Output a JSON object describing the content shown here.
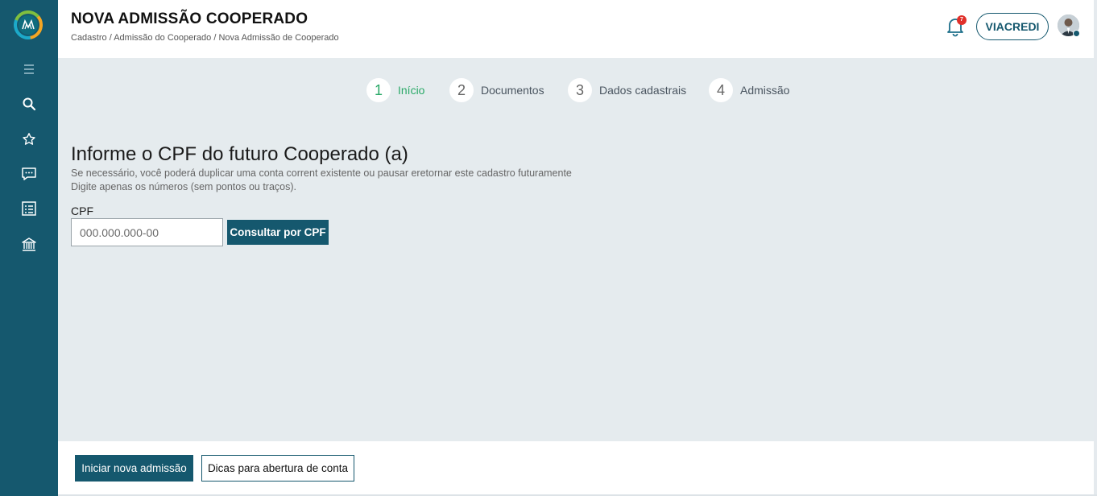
{
  "header": {
    "title": "NOVA ADMISSÃO COOPERADO",
    "breadcrumb": "Cadastro / Admissão do Cooperado / Nova Admissão de Cooperado",
    "notification_count": "7",
    "org_button": "VIACREDI"
  },
  "sidebar": {
    "items": [
      {
        "icon": "menu-icon"
      },
      {
        "icon": "search-icon"
      },
      {
        "icon": "star-icon"
      },
      {
        "icon": "chat-icon"
      },
      {
        "icon": "checklist-icon"
      },
      {
        "icon": "bank-icon"
      }
    ]
  },
  "steps": [
    {
      "number": "1",
      "label": "Início",
      "active": true
    },
    {
      "number": "2",
      "label": "Documentos",
      "active": false
    },
    {
      "number": "3",
      "label": "Dados cadastrais",
      "active": false
    },
    {
      "number": "4",
      "label": "Admissão",
      "active": false
    }
  ],
  "form": {
    "title": "Informe o CPF do futuro Cooperado (a)",
    "description_1": "Se necessário, você poderá duplicar uma conta corrent existente ou pausar eretornar este cadastro futuramente",
    "description_2": "Digite apenas os números (sem pontos ou traços).",
    "cpf_label": "CPF",
    "cpf_placeholder": "000.000.000-00",
    "cpf_value": "",
    "consult_button": "Consultar por CPF"
  },
  "footer": {
    "primary_button": "Iniciar nova admissão",
    "secondary_button": "Dicas para abertura de conta"
  },
  "colors": {
    "brand": "#15586e",
    "active_step": "#2aa968",
    "content_bg": "#e5ebee",
    "badge": "#e0302a"
  }
}
